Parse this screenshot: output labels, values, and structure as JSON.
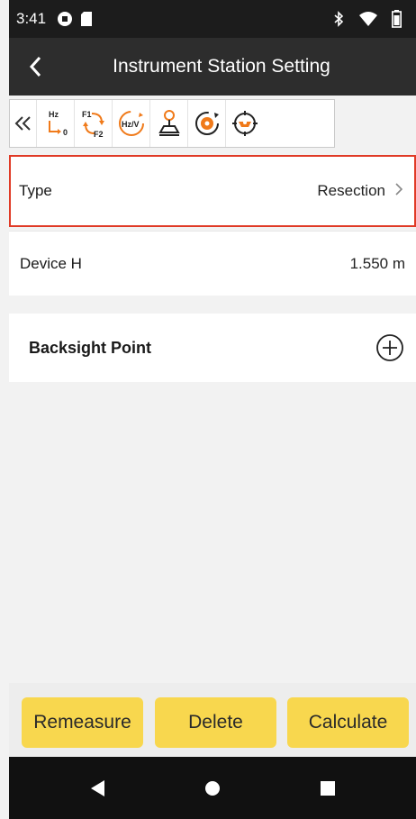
{
  "status_bar": {
    "time": "3:41",
    "icons": [
      "sync-icon",
      "sd-card-icon",
      "bluetooth-icon",
      "wifi-icon",
      "battery-icon"
    ]
  },
  "header": {
    "title": "Instrument Station Setting",
    "back_icon": "chevron-left-icon"
  },
  "toolbar": {
    "collapse_icon": "double-chevron-left-icon",
    "tools": [
      {
        "name": "hz-zero-icon",
        "line1": "Hz",
        "line2": "0"
      },
      {
        "name": "f1-f2-swap-icon",
        "line1": "F1",
        "line2": "F2"
      },
      {
        "name": "hz-v-icon",
        "label": "Hz/V"
      },
      {
        "name": "joystick-icon"
      },
      {
        "name": "rotate-target-icon"
      },
      {
        "name": "crosshair-target-icon"
      }
    ]
  },
  "rows": {
    "type": {
      "label": "Type",
      "value": "Resection"
    },
    "device_h": {
      "label": "Device H",
      "value": "1.550 m"
    },
    "backsight": {
      "label": "Backsight Point"
    }
  },
  "buttons": {
    "remeasure": "Remeasure",
    "delete": "Delete",
    "calculate": "Calculate"
  },
  "colors": {
    "accent": "#f8d74e",
    "highlight": "#e03a26",
    "orange_icon": "#f07a1a"
  }
}
